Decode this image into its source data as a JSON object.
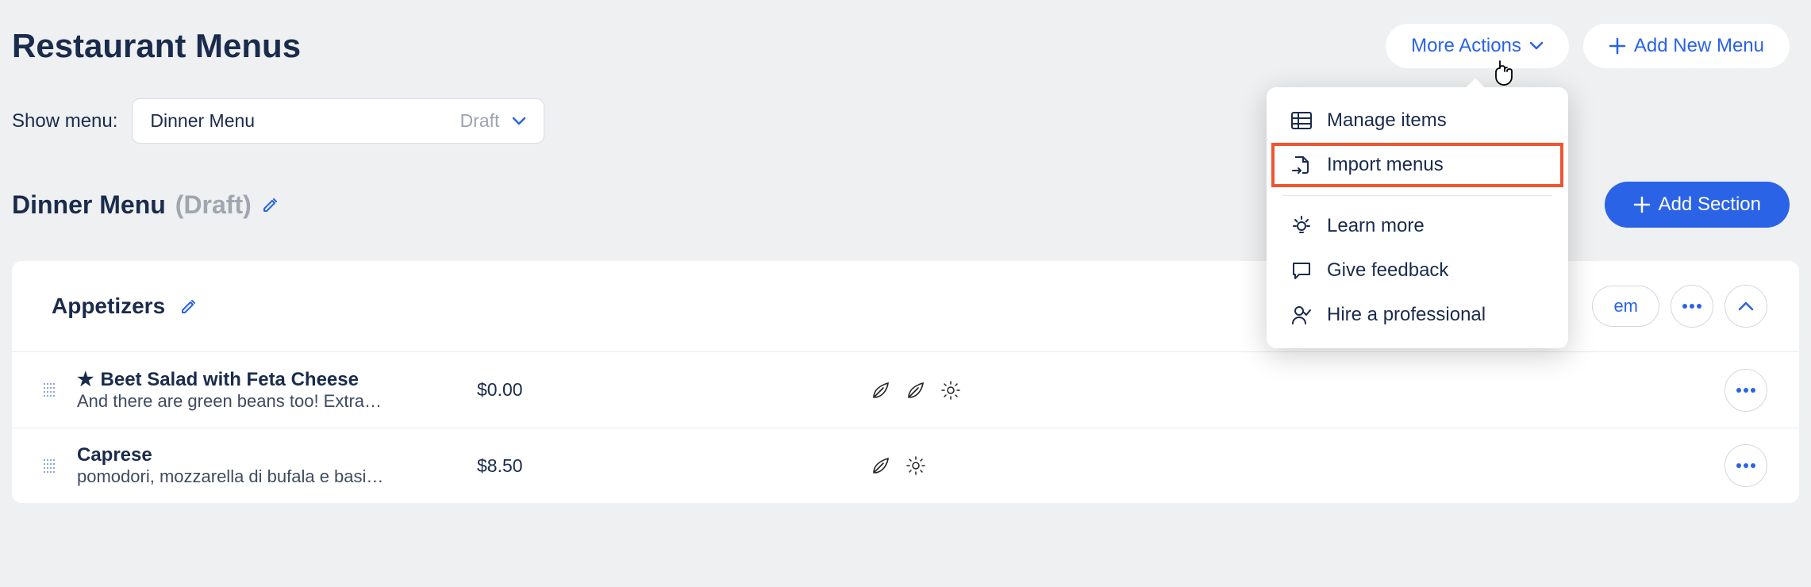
{
  "header": {
    "title": "Restaurant Menus",
    "more_actions_label": "More Actions",
    "add_menu_label": "Add New Menu"
  },
  "menu_selector": {
    "label": "Show menu:",
    "selected": "Dinner Menu",
    "status": "Draft"
  },
  "subheader": {
    "menu_name": "Dinner Menu",
    "status_display": "(Draft)",
    "add_section_label": "Add Section"
  },
  "section": {
    "title": "Appetizers",
    "add_item_partial_label": "em",
    "items": [
      {
        "starred": true,
        "name": "Beet Salad with Feta Cheese",
        "description": "And there are green beans too! Extra…",
        "price": "$0.00",
        "icon_slots": [
          "leaf",
          "leaf",
          "sun"
        ]
      },
      {
        "starred": false,
        "name": "Caprese",
        "description": "pomodori, mozzarella di bufala e basi…",
        "price": "$8.50",
        "icon_slots": [
          "leaf",
          "sun"
        ]
      }
    ]
  },
  "dropdown": {
    "items": [
      {
        "icon": "grid",
        "label": "Manage items",
        "highlight": false
      },
      {
        "icon": "import",
        "label": "Import menus",
        "highlight": true
      },
      {
        "sep": true
      },
      {
        "icon": "bulb",
        "label": "Learn more",
        "highlight": false
      },
      {
        "icon": "chat",
        "label": "Give feedback",
        "highlight": false
      },
      {
        "icon": "person",
        "label": "Hire a professional",
        "highlight": false
      }
    ]
  }
}
